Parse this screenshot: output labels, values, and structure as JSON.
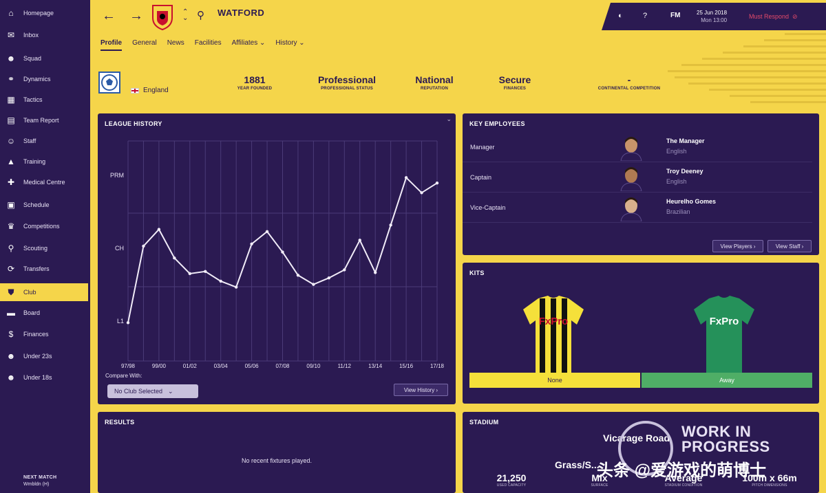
{
  "sidebar": {
    "items": [
      {
        "label": "Homepage",
        "icon": "home-icon",
        "glyph": "⌂"
      },
      {
        "label": "Inbox",
        "icon": "inbox-icon",
        "glyph": "✉"
      },
      {
        "label": "Squad",
        "icon": "squad-icon",
        "glyph": "☻"
      },
      {
        "label": "Dynamics",
        "icon": "dynamics-icon",
        "glyph": "⚭"
      },
      {
        "label": "Tactics",
        "icon": "tactics-icon",
        "glyph": "▦"
      },
      {
        "label": "Team Report",
        "icon": "report-icon",
        "glyph": "▤"
      },
      {
        "label": "Staff",
        "icon": "staff-icon",
        "glyph": "☺"
      },
      {
        "label": "Training",
        "icon": "training-icon",
        "glyph": "▲"
      },
      {
        "label": "Medical Centre",
        "icon": "medical-icon",
        "glyph": "✚"
      },
      {
        "label": "Schedule",
        "icon": "calendar-icon",
        "glyph": "▣"
      },
      {
        "label": "Competitions",
        "icon": "trophy-icon",
        "glyph": "♛"
      },
      {
        "label": "Scouting",
        "icon": "magnifier-icon",
        "glyph": "⚲"
      },
      {
        "label": "Transfers",
        "icon": "transfers-icon",
        "glyph": "⟳"
      },
      {
        "label": "Club",
        "icon": "shield-icon",
        "glyph": "⛊"
      },
      {
        "label": "Board",
        "icon": "board-icon",
        "glyph": "▬"
      },
      {
        "label": "Finances",
        "icon": "finances-icon",
        "glyph": "$"
      },
      {
        "label": "Under 23s",
        "icon": "under23-icon",
        "glyph": "☻"
      },
      {
        "label": "Under 18s",
        "icon": "under18-icon",
        "glyph": "☻"
      }
    ],
    "active_index": 13,
    "next_match_label": "NEXT MATCH",
    "next_match_value": "Wmbldn (H)"
  },
  "header": {
    "club_name": "WATFORD",
    "subtabs": [
      "Profile",
      "General",
      "News",
      "Facilities",
      "Affiliates ⌄",
      "History ⌄"
    ],
    "active_subtab": 0,
    "status": {
      "fm_label": "FM",
      "date": "25 Jun 2018",
      "time": "Mon 13:00",
      "must_respond": "Must Respond"
    }
  },
  "club_info": {
    "nation": "England",
    "stats": [
      {
        "value": "1881",
        "label": "YEAR FOUNDED"
      },
      {
        "value": "Professional",
        "label": "PROFESSIONAL STATUS"
      },
      {
        "value": "National",
        "label": "REPUTATION"
      },
      {
        "value": "Secure",
        "label": "FINANCES"
      },
      {
        "value": "-",
        "label": "CONTINENTAL COMPETITION"
      }
    ]
  },
  "league_history": {
    "title": "LEAGUE HISTORY",
    "compare_label": "Compare With:",
    "compare_value": "No Club Selected",
    "view_button": "View History ›"
  },
  "chart_data": {
    "type": "line",
    "title": "LEAGUE HISTORY",
    "y_tick_labels": [
      "PRM",
      "CH",
      "L1"
    ],
    "x_tick_labels": [
      "97/98",
      "99/00",
      "01/02",
      "03/04",
      "05/06",
      "07/08",
      "09/10",
      "11/12",
      "13/14",
      "15/16",
      "17/18"
    ],
    "x": [
      "97/98",
      "98/99",
      "99/00",
      "00/01",
      "01/02",
      "02/03",
      "03/04",
      "04/05",
      "05/06",
      "06/07",
      "07/08",
      "08/09",
      "09/10",
      "10/11",
      "11/12",
      "12/13",
      "13/14",
      "14/15",
      "15/16",
      "16/17",
      "17/18"
    ],
    "series": [
      {
        "values": [
          23.2,
          9,
          5.9,
          11.2,
          14.1,
          13.7,
          15.5,
          16.6,
          8.6,
          6.3,
          10.1,
          14.4,
          16.1,
          14.9,
          13.4,
          7.9,
          13.9,
          5.1,
          -3.7,
          -0.9,
          -2.7
        ]
      }
    ],
    "ylim": [
      -10.5,
      30.3
    ],
    "y_scale": "league position (PRM top, L1 bottom)",
    "grid": true,
    "legend": "none"
  },
  "key_employees": {
    "title": "KEY EMPLOYEES",
    "rows": [
      {
        "role": "Manager",
        "name": "The Manager",
        "nationality": "English"
      },
      {
        "role": "Captain",
        "name": "Troy Deeney",
        "nationality": "English"
      },
      {
        "role": "Vice-Captain",
        "name": "Heurelho Gomes",
        "nationality": "Brazilian"
      }
    ],
    "view_players": "View Players ›",
    "view_staff": "View Staff ›"
  },
  "kits": {
    "title": "KITS",
    "home_label": "None",
    "away_label": "Away",
    "sponsor": "FxPro",
    "home_color": "#f5e03a",
    "away_color": "#4fae66"
  },
  "results": {
    "title": "RESULTS",
    "empty_text": "No recent fixtures played."
  },
  "stadium": {
    "title": "STADIUM",
    "name": "Vicarage Road",
    "stats": [
      {
        "value": "21,250",
        "label": "USED CAPACITY"
      },
      {
        "value": "Grass/S...",
        "label": "SURFACE",
        "value2": "Mix"
      },
      {
        "value": "Average",
        "label": "STADIUM CONDITION"
      },
      {
        "value": "100m x 66m",
        "label": "PITCH DIMENSIONS"
      }
    ]
  },
  "overlay": {
    "wip_line1": "WORK IN",
    "wip_line2": "PROGRESS",
    "watermark": "头条 @爱游戏的萌博士"
  }
}
